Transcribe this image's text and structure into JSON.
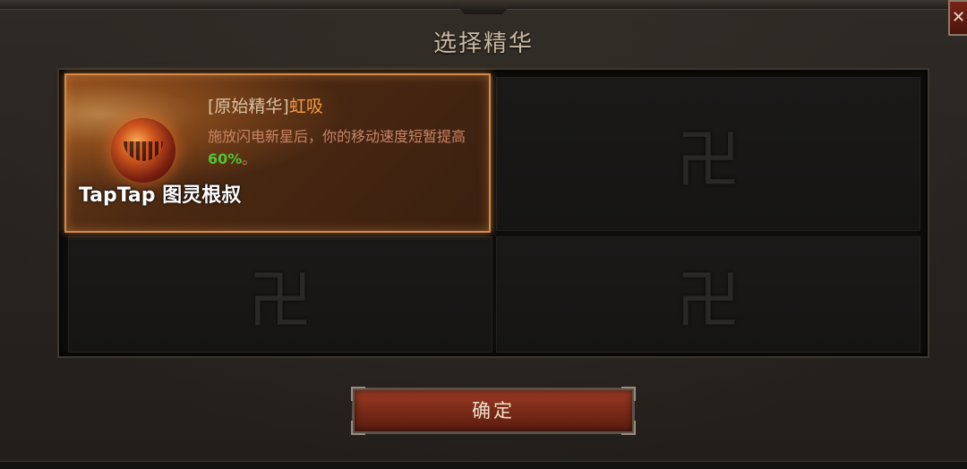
{
  "dialog": {
    "title": "选择精华",
    "close_label": "✕"
  },
  "slots": {
    "selected": {
      "name_prefix": "[原始精华]",
      "name_highlight": "虹吸",
      "description": "施放闪电新星后，你的移动速度短暂提高",
      "percent": "60%",
      "description_end": "。",
      "watermark": "TapTap 图灵根叔",
      "icon": "essence-gem-icon"
    },
    "empty_emblem": "卍",
    "empty_count": 3
  },
  "confirm_button": {
    "label": "确定"
  },
  "colors": {
    "highlight": "#f39a42",
    "description": "#c88466",
    "percent": "#53c234",
    "border_selected": "#d58a4a"
  }
}
